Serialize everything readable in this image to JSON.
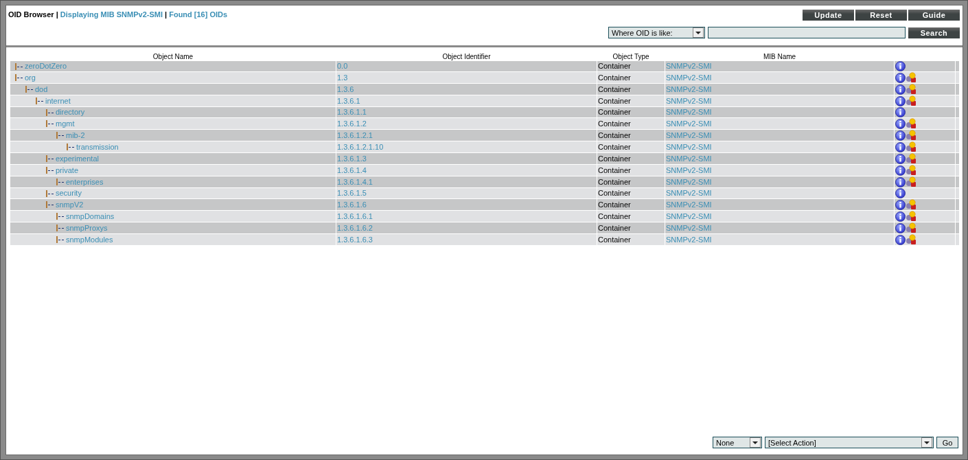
{
  "header": {
    "title": "OID Browser",
    "separator_1": "|",
    "mib_link": "Displaying MIB SNMPv2-SMI",
    "separator_2": "|",
    "found_link": "Found [16] OIDs"
  },
  "toolbar_buttons": [
    "Update",
    "Reset",
    "Guide"
  ],
  "search": {
    "filter": "Where OID is like:",
    "button": "Search"
  },
  "table": {
    "columns": [
      "Object Name",
      "Object Identifier",
      "Object Type",
      "MIB Name"
    ],
    "rows": [
      {
        "name": "zeroDotZero",
        "oid": "0.0",
        "type": "Container",
        "mib": "SNMPv2-SMI",
        "has_objects": false
      },
      {
        "name": "org",
        "oid": "1.3",
        "type": "Container",
        "mib": "SNMPv2-SMI",
        "has_objects": true,
        "children": [
          {
            "name": "dod",
            "oid": "1.3.6",
            "type": "Container",
            "mib": "SNMPv2-SMI",
            "has_objects": true,
            "children": [
              {
                "name": "internet",
                "oid": "1.3.6.1",
                "type": "Container",
                "mib": "SNMPv2-SMI",
                "has_objects": true,
                "children": [
                  {
                    "name": "directory",
                    "oid": "1.3.6.1.1",
                    "type": "Container",
                    "mib": "SNMPv2-SMI",
                    "has_objects": false
                  },
                  {
                    "name": "mgmt",
                    "oid": "1.3.6.1.2",
                    "type": "Container",
                    "mib": "SNMPv2-SMI",
                    "has_objects": true,
                    "children": [
                      {
                        "name": "mib-2",
                        "oid": "1.3.6.1.2.1",
                        "type": "Container",
                        "mib": "SNMPv2-SMI",
                        "has_objects": true,
                        "children": [
                          {
                            "name": "transmission",
                            "oid": "1.3.6.1.2.1.10",
                            "type": "Container",
                            "mib": "SNMPv2-SMI",
                            "has_objects": true
                          }
                        ]
                      }
                    ]
                  },
                  {
                    "name": "experimental",
                    "oid": "1.3.6.1.3",
                    "type": "Container",
                    "mib": "SNMPv2-SMI",
                    "has_objects": true
                  },
                  {
                    "name": "private",
                    "oid": "1.3.6.1.4",
                    "type": "Container",
                    "mib": "SNMPv2-SMI",
                    "has_objects": true,
                    "children": [
                      {
                        "name": "enterprises",
                        "oid": "1.3.6.1.4.1",
                        "type": "Container",
                        "mib": "SNMPv2-SMI",
                        "has_objects": true
                      }
                    ]
                  },
                  {
                    "name": "security",
                    "oid": "1.3.6.1.5",
                    "type": "Container",
                    "mib": "SNMPv2-SMI",
                    "has_objects": false
                  },
                  {
                    "name": "snmpV2",
                    "oid": "1.3.6.1.6",
                    "type": "Container",
                    "mib": "SNMPv2-SMI",
                    "has_objects": true,
                    "children": [
                      {
                        "name": "snmpDomains",
                        "oid": "1.3.6.1.6.1",
                        "type": "Container",
                        "mib": "SNMPv2-SMI",
                        "has_objects": true
                      },
                      {
                        "name": "snmpProxys",
                        "oid": "1.3.6.1.6.2",
                        "type": "Container",
                        "mib": "SNMPv2-SMI",
                        "has_objects": true
                      },
                      {
                        "name": "snmpModules",
                        "oid": "1.3.6.1.6.3",
                        "type": "Container",
                        "mib": "SNMPv2-SMI",
                        "has_objects": true
                      }
                    ]
                  }
                ]
              }
            ]
          }
        ]
      }
    ]
  },
  "footer": {
    "selection": "None",
    "action": "[Select Action]",
    "go": "Go"
  }
}
